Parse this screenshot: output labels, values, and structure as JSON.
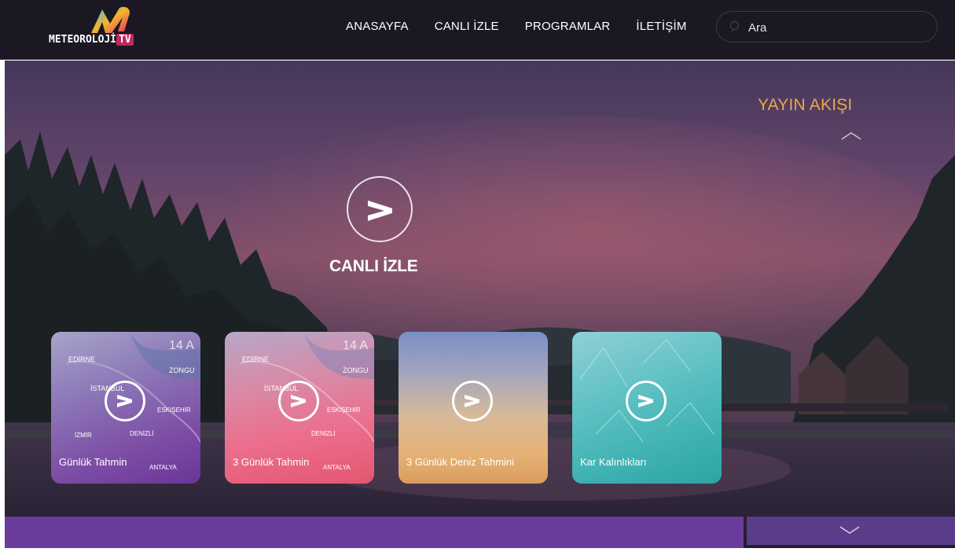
{
  "brand": {
    "logo_text": "METEOROLOJİ",
    "logo_tv": "TV"
  },
  "nav": {
    "items": [
      "ANASAYFA",
      "CANLI İZLE",
      "PROGRAMLAR",
      "İLETİŞİM"
    ]
  },
  "search": {
    "placeholder": "Ara"
  },
  "hero": {
    "live_label": "CANLI İZLE"
  },
  "schedule": {
    "title": "YAYIN AKIŞI"
  },
  "cards": [
    {
      "title": "Günlük Tahmin"
    },
    {
      "title": "3 Günlük Tahmin"
    },
    {
      "title": "3 Günlük Deniz Tahmini"
    },
    {
      "title": "Kar Kalınlıkları"
    }
  ],
  "map_labels": {
    "date": "14 A",
    "cities": [
      "EDİRNE",
      "İSTANBUL",
      "ZONGU",
      "ESKİŞEHİR",
      "DENİZLİ",
      "İZMİR",
      "ANTALYA"
    ]
  },
  "colors": {
    "nav_bg": "#1b1823",
    "accent_orange": "#f0a44a",
    "purple_bar": "#6a3c9c",
    "logo_tv": "#c3265e"
  }
}
